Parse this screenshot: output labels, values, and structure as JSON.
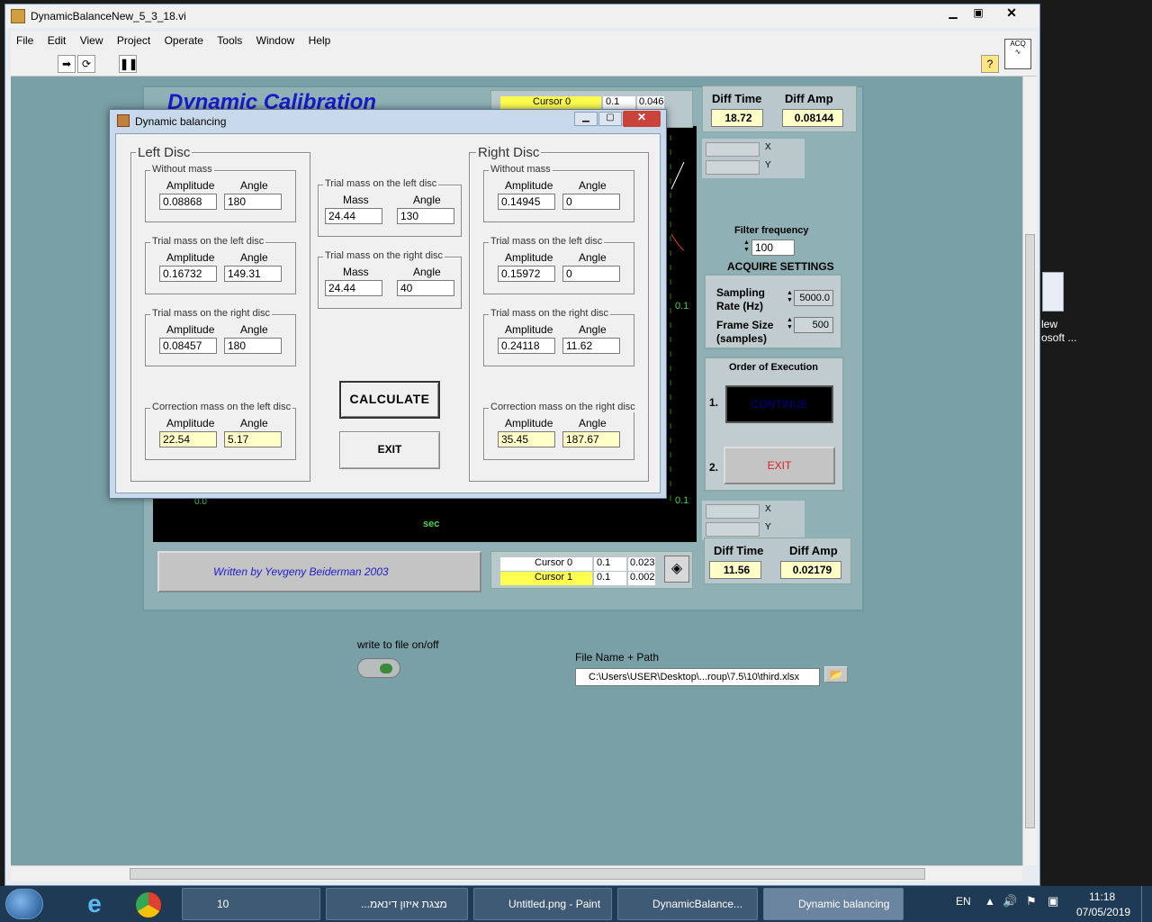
{
  "window": {
    "title": "DynamicBalanceNew_5_3_18.vi",
    "menu": [
      "File",
      "Edit",
      "View",
      "Project",
      "Operate",
      "Tools",
      "Window",
      "Help"
    ]
  },
  "vi": {
    "heading": "Dynamic Calibration",
    "top_cursor": {
      "name": "Cursor 0",
      "x": "0.1",
      "y": "0.046"
    },
    "top_diff_time_label": "Diff Time",
    "top_diff_amp_label": "Diff Amp",
    "top_diff_time": "18.72",
    "top_diff_amp": "0.08144",
    "filter_label": "Filter frequency",
    "filter_value": "100",
    "acquire_title": "ACQUIRE SETTINGS",
    "sampling_label": "Sampling Rate (Hz)",
    "sampling_value": "5000.0",
    "frame_label": "Frame Size (samples)",
    "frame_value": "500",
    "order_title": "Order of Execution",
    "order_1": "1.",
    "order_2": "2.",
    "continue_label": "CONTINUE",
    "exit_label": "EXIT",
    "graph_axis_top": "0.1",
    "graph_axis_bottom": "0.1",
    "graph_x_start": "0.0",
    "graph_xlabel": "sec",
    "author": "Written by Yevgeny Beiderman 2003",
    "bottom_cursor0": {
      "name": "Cursor 0",
      "x": "0.1",
      "y": "0.023"
    },
    "bottom_cursor1": {
      "name": "Cursor 1",
      "x": "0.1",
      "y": "0.002"
    },
    "bottom_diff_time_label": "Diff Time",
    "bottom_diff_amp_label": "Diff Amp",
    "bottom_diff_time": "11.56",
    "bottom_diff_amp": "0.02179",
    "write_label": "write to file on/off",
    "path_label": "File Name + Path",
    "path_value": "C:\\Users\\USER\\Desktop\\...roup\\7.5\\10\\third.xlsx",
    "cursor_fmt_x": "X",
    "cursor_fmt_y": "Y"
  },
  "dialog": {
    "title": "Dynamic balancing",
    "left_title": "Left Disc",
    "right_title": "Right Disc",
    "amplitude": "Amplitude",
    "angle": "Angle",
    "mass": "Mass",
    "without_mass": "Without mass",
    "trial_left": "Trial mass on the left disc",
    "trial_right": "Trial mass on the right disc",
    "corr_left": "Correction mass on the left disc",
    "corr_right": "Correction mass on the right disc",
    "left": {
      "without_amp": "0.08868",
      "without_ang": "180",
      "trial_left_amp": "0.16732",
      "trial_left_ang": "149.31",
      "trial_right_amp": "0.08457",
      "trial_right_ang": "180",
      "corr_amp": "22.54",
      "corr_ang": "5.17"
    },
    "middle": {
      "trial_left_mass": "24.44",
      "trial_left_ang": "130",
      "trial_right_mass": "24.44",
      "trial_right_ang": "40"
    },
    "right": {
      "without_amp": "0.14945",
      "without_ang": "0",
      "trial_left_amp": "0.15972",
      "trial_left_ang": "0",
      "trial_right_amp": "0.24118",
      "trial_right_ang": "11.62",
      "corr_amp": "35.45",
      "corr_ang": "187.67"
    },
    "calculate": "CALCULATE",
    "exit": "EXIT"
  },
  "desktop": {
    "icon_label_1": "lew",
    "icon_label_2": "osoft ..."
  },
  "taskbar": {
    "items": [
      "10",
      "מצגת איזון דינאמ...",
      "Untitled.png - Paint",
      "DynamicBalance...",
      "Dynamic balancing"
    ],
    "lang": "EN",
    "time": "11:18",
    "date": "07/05/2019"
  }
}
